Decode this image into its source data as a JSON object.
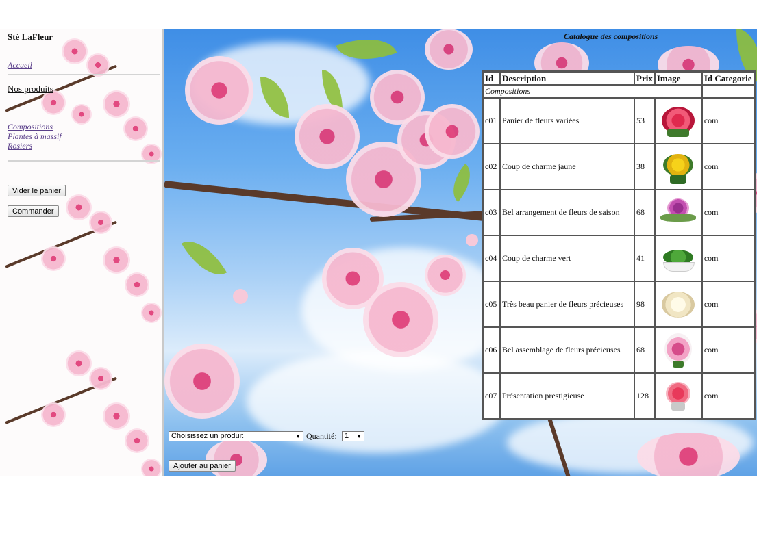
{
  "sidebar": {
    "company": "Sté LaFleur",
    "home_link": "Accueil",
    "products_heading": "Nos produits",
    "categories": [
      "Compositions",
      "Plantes à massif",
      "Rosiers"
    ],
    "empty_cart_button": "Vider le panier",
    "order_button": "Commander"
  },
  "main": {
    "catalog_title": "Catalogue des compositions",
    "table": {
      "headers": [
        "Id",
        "Description",
        "Prix",
        "Image",
        "Id Categorie"
      ],
      "group_label": "Compositions",
      "rows": [
        {
          "id": "c01",
          "description": "Panier de fleurs variées",
          "price": "53",
          "category": "com",
          "image_icon": "mixed-flower-basket-icon"
        },
        {
          "id": "c02",
          "description": "Coup de charme jaune",
          "price": "38",
          "category": "com",
          "image_icon": "yellow-bouquet-icon"
        },
        {
          "id": "c03",
          "description": "Bel arrangement de fleurs de saison",
          "price": "68",
          "category": "com",
          "image_icon": "seasonal-arrangement-icon"
        },
        {
          "id": "c04",
          "description": "Coup de charme vert",
          "price": "41",
          "category": "com",
          "image_icon": "green-plant-bowl-icon"
        },
        {
          "id": "c05",
          "description": "Très beau panier de fleurs précieuses",
          "price": "98",
          "category": "com",
          "image_icon": "white-flower-basket-icon"
        },
        {
          "id": "c06",
          "description": "Bel assemblage de fleurs précieuses",
          "price": "68",
          "category": "com",
          "image_icon": "lily-arrangement-icon"
        },
        {
          "id": "c07",
          "description": "Présentation prestigieuse",
          "price": "128",
          "category": "com",
          "image_icon": "pink-rose-bouquet-icon"
        }
      ]
    },
    "product_select": "Choisissez un produit",
    "quantity_label": "Quantité:",
    "quantity_value": "1",
    "add_to_cart_button": "Ajouter au panier"
  },
  "colors": {
    "sky": "#6aaef0",
    "blossom": "#f6b8cf",
    "link": "#5a3f8a"
  }
}
